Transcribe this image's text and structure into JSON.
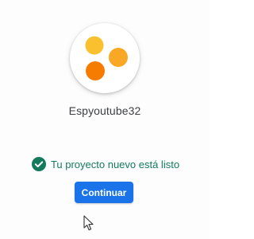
{
  "project": {
    "name": "Espyoutube32",
    "avatar_icon": "orange-dots-logo-icon",
    "avatar_colors": {
      "top_left": "#fbc02d",
      "right": "#f9a825",
      "bottom_left": "#f57c00"
    }
  },
  "status": {
    "icon": "check-circle-icon",
    "text": "Tu proyecto nuevo está listo",
    "color": "#137a5c"
  },
  "actions": {
    "continue_label": "Continuar",
    "accent": "#1a73e8"
  },
  "pointer": {
    "icon": "mouse-pointer-icon"
  }
}
